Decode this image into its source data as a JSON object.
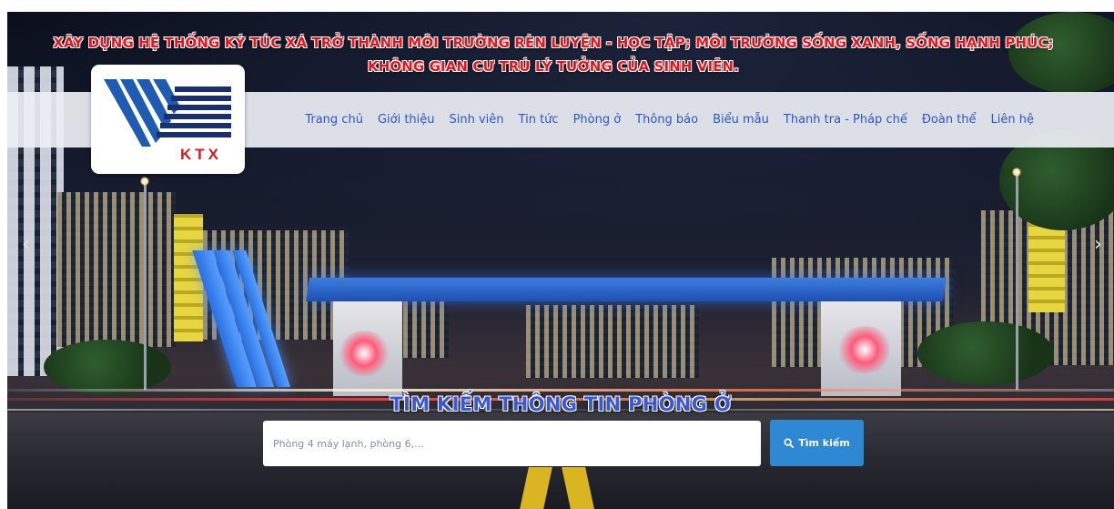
{
  "slogan": {
    "line1": "XÂY DỰNG HỆ THỐNG KÝ TÚC XÁ TRỞ THÀNH MÔI TRƯỜNG RÈN LUYỆN - HỌC TẬP; MÔI TRƯỜNG SỐNG XANH, SỐNG HẠNH PHÚC;",
    "line2": "KHÔNG GIAN CƯ TRÚ LÝ TƯỞNG CỦA SINH VIÊN."
  },
  "logo": {
    "letters": "KTX"
  },
  "nav": {
    "items": [
      "Trang chủ",
      "Giới thiệu",
      "Sinh viên",
      "Tin tức",
      "Phòng ở",
      "Thông báo",
      "Biểu mẫu",
      "Thanh tra - Pháp chế",
      "Đoàn thể",
      "Liên hệ"
    ]
  },
  "carousel": {
    "prev_icon": "chevron-left-icon",
    "next_icon": "chevron-right-icon"
  },
  "search": {
    "title": "TÌM KIẾM THÔNG TIN PHÒNG Ở",
    "placeholder": "Phòng 4 máy lạnh, phòng 6,...",
    "value": "",
    "button_label": "Tìm kiếm",
    "button_icon": "search-icon"
  },
  "colors": {
    "slogan": "#e8141c",
    "nav_link": "#2b57c9",
    "search_title": "#3a57d6",
    "search_button": "#2f88d4"
  }
}
